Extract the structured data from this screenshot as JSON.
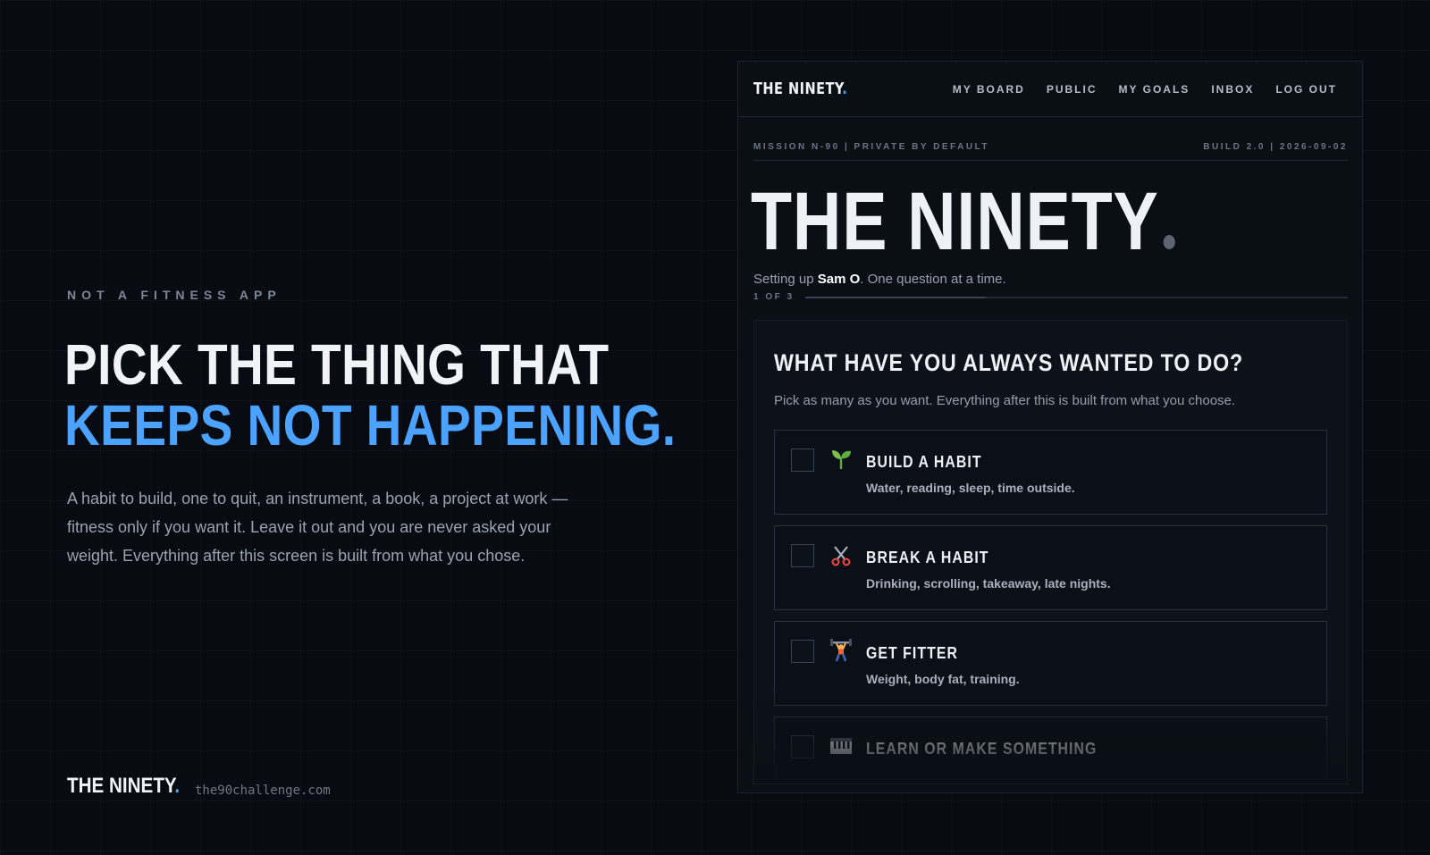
{
  "landing": {
    "eyebrow": "NOT A FITNESS APP",
    "headline_line1": "PICK THE THING THAT",
    "headline_line2": "KEEPS NOT HAPPENING.",
    "body": "A habit to build, one to quit, an instrument, a book, a project at work — fitness only if you want it. Leave it out and you are never asked your weight. Everything after this screen is built from what you chose.",
    "footer_brand": "THE NINETY",
    "footer_brand_dot": ".",
    "footer_url": "the90challenge.com"
  },
  "app": {
    "brand": "THE NINETY",
    "brand_dot": ".",
    "nav": [
      "MY BOARD",
      "PUBLIC",
      "MY GOALS",
      "INBOX",
      "LOG OUT"
    ],
    "meta_left": "MISSION N-90 | PRIVATE BY DEFAULT",
    "meta_right": "BUILD 2.0 | 2026-09-02",
    "title": "THE NINETY",
    "setup_prefix": "Setting up ",
    "setup_name": "Sam O",
    "setup_suffix": ". One question at a time.",
    "progress_label": "1 OF 3",
    "progress_fraction": 0.333,
    "question": {
      "title": "WHAT HAVE YOU ALWAYS WANTED TO DO?",
      "subtitle": "Pick as many as you want. Everything after this is built from what you choose.",
      "options": [
        {
          "title": "BUILD A HABIT",
          "desc": "Water, reading, sleep, time outside.",
          "icon": "seedling-icon",
          "checked": false
        },
        {
          "title": "BREAK A HABIT",
          "desc": "Drinking, scrolling, takeaway, late nights.",
          "icon": "scissors-icon",
          "checked": false
        },
        {
          "title": "GET FITTER",
          "desc": "Weight, body fat, training.",
          "icon": "weightlifter-icon",
          "checked": false
        },
        {
          "title": "LEARN OR MAKE SOMETHING",
          "desc": "",
          "icon": "piano-icon",
          "checked": false
        }
      ]
    }
  },
  "colors": {
    "accent": "#4ba3ff",
    "background": "#080b11",
    "panel": "#0a0e15"
  }
}
